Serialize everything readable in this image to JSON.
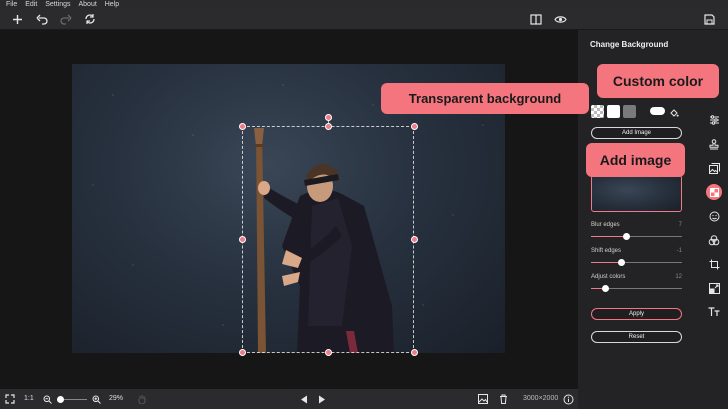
{
  "menu": [
    "File",
    "Edit",
    "Settings",
    "About",
    "Help"
  ],
  "toolbar": {
    "icons": [
      "plus-icon",
      "undo-icon",
      "redo-icon",
      "reset-icon",
      "compare-icon",
      "eye-icon",
      "save-icon"
    ]
  },
  "panel": {
    "title": "Change Background",
    "add_image_label": "Add Image",
    "blur_label": "Blur edges",
    "blur_value": "7",
    "shift_label": "Shift edges",
    "shift_value": "-1",
    "adjust_label": "Adjust colors",
    "adjust_value": "12",
    "apply_label": "Apply",
    "reset_label": "Reset",
    "sliders": {
      "blur": 0.38,
      "shift": 0.33,
      "adjust": 0.15
    }
  },
  "callouts": {
    "transparent": "Transparent background",
    "custom_color": "Custom color",
    "add_image": "Add image"
  },
  "bottom": {
    "ratio": "1:1",
    "zoom": "29%",
    "dimensions": "3000×2000"
  },
  "colors": {
    "accent": "#f5757f",
    "panel": "#232325",
    "toolbar": "#2b2b2e"
  }
}
